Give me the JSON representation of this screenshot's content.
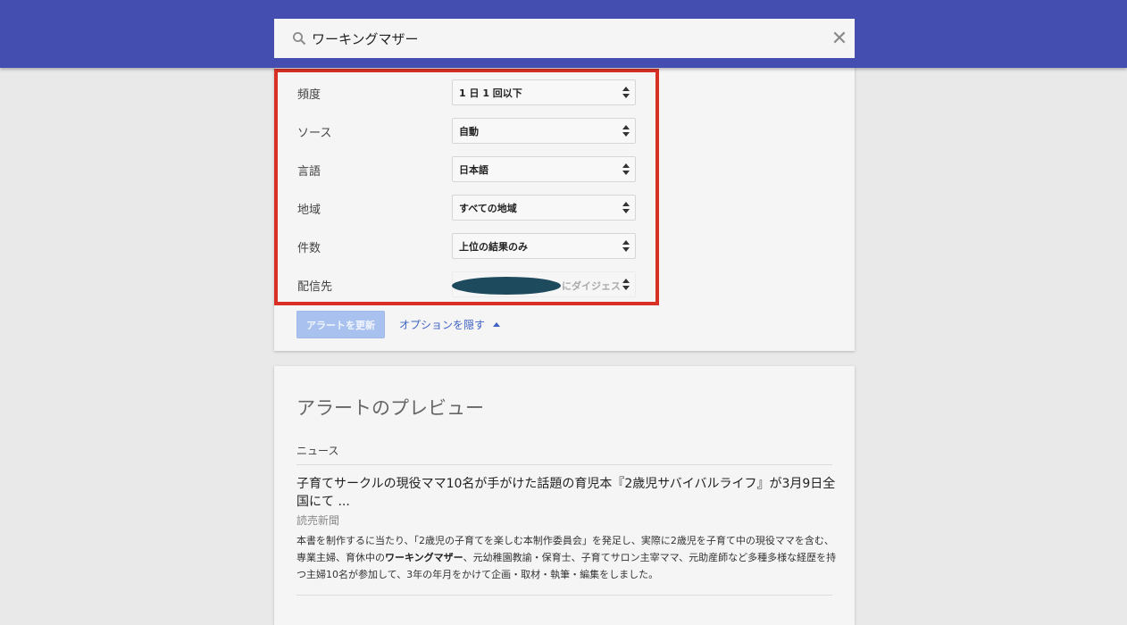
{
  "search": {
    "query": "ワーキングマザー",
    "clear_label": "✕"
  },
  "options": {
    "rows": [
      {
        "label": "頻度",
        "value": "1 日 1 回以下"
      },
      {
        "label": "ソース",
        "value": "自動"
      },
      {
        "label": "言語",
        "value": "日本語"
      },
      {
        "label": "地域",
        "value": "すべての地域"
      },
      {
        "label": "件数",
        "value": "上位の結果のみ"
      }
    ],
    "delivery": {
      "label": "配信先",
      "value": "にダイジェス"
    },
    "update_label": "アラートを更新",
    "hide_options_label": "オプションを隠す"
  },
  "preview": {
    "title": "アラートのプレビュー",
    "section": "ニュース",
    "article": {
      "title": "子育てサークルの現役ママ10名が手がけた話題の育児本『2歳児サバイバルライフ』が3月9日全国にて ...",
      "source": "読売新聞",
      "snippet_pre": "本書を制作するに当たり、「2歳児の子育てを楽しむ本制作委員会」を発足し、実際に2歳児を子育て中の現役ママを含む、専業主婦、育休中の",
      "snippet_highlight": "ワーキングマザー",
      "snippet_post": "、元幼稚園教諭・保育士、子育てサロン主宰ママ、元助産師など多種多様な経歴を持つ主婦10名が参加して、3年の年月をかけて企画・取材・執筆・編集をしました。"
    }
  }
}
